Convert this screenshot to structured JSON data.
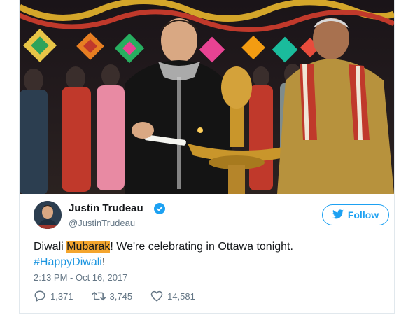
{
  "tweet": {
    "author_name": "Justin Trudeau",
    "handle": "@JustinTrudeau",
    "follow_label": "Follow",
    "text_prefix": "Diwali ",
    "text_highlight": "Mubarak",
    "text_rest": "! We're celebrating in Ottawa tonight.",
    "hashtag": "#HappyDiwali",
    "hashtag_suffix": "!",
    "timestamp": "2:13 PM - Oct 16, 2017",
    "replies": "1,371",
    "retweets": "3,745",
    "likes": "14,581"
  },
  "icons": {
    "verified": "verified-badge-icon",
    "follow": "twitter-bird-icon",
    "reply": "reply-icon",
    "retweet": "retweet-icon",
    "like": "heart-icon"
  },
  "colors": {
    "accent": "#1da1f2",
    "hashtag": "#1b95e0",
    "highlight": "#f4a52d",
    "muted": "#657786",
    "text": "#14171a"
  }
}
